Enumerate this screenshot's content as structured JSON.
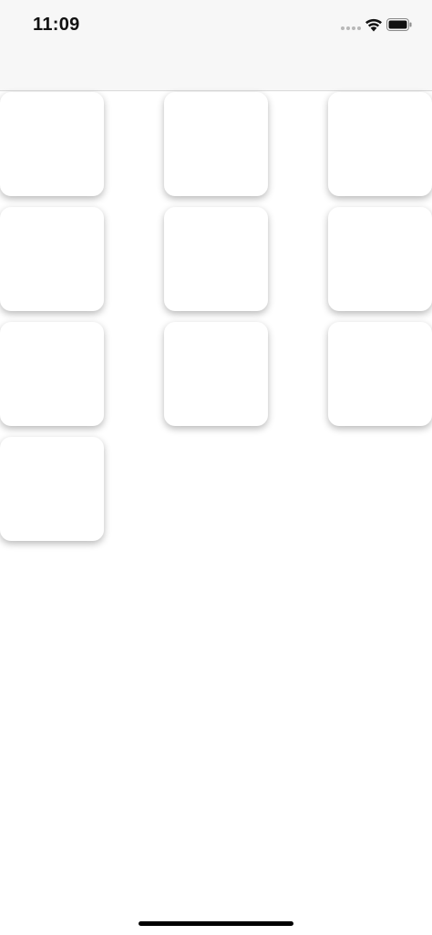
{
  "status_bar": {
    "time": "11:09",
    "icons": [
      "cellular-signal-icon",
      "wifi-icon",
      "battery-icon"
    ]
  },
  "grid": {
    "tile_count": 10,
    "columns": 3
  },
  "colors": {
    "status_bar_bg": "#f7f7f7",
    "page_bg": "#ffffff",
    "tile_bg": "#ffffff"
  }
}
